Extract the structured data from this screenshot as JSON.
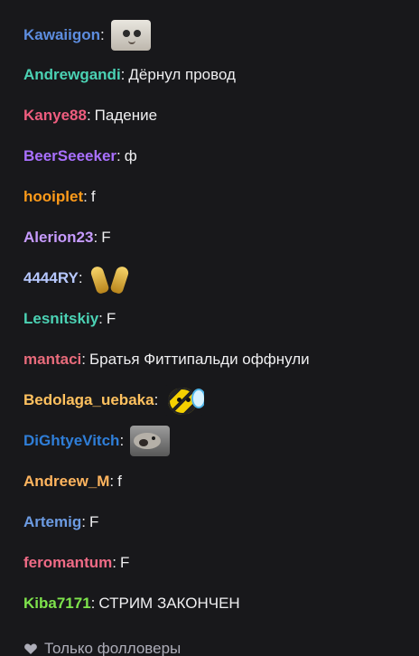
{
  "chat": {
    "cut_user": "",
    "messages": [
      {
        "user": "Kawaiigon",
        "color": "#5d8ddf",
        "text": "",
        "emote": "crying-cat-emote"
      },
      {
        "user": "Andrewgandi",
        "color": "#4bd2b4",
        "text": "Дёрнул провод",
        "emote": ""
      },
      {
        "user": "Kanye88",
        "color": "#ef5d7f",
        "text": "Падение",
        "emote": ""
      },
      {
        "user": "BeerSeeeker",
        "color": "#a970ff",
        "text": "ф",
        "emote": ""
      },
      {
        "user": "hooiplet",
        "color": "#ff9b1a",
        "text": "f",
        "emote": ""
      },
      {
        "user": "Alerion23",
        "color": "#c79bff",
        "text": "F",
        "emote": ""
      },
      {
        "user": "4444RY",
        "color": "#b7c8ff",
        "text": "",
        "emote": "praying-hands-emote"
      },
      {
        "user": "Lesnitskiy",
        "color": "#4bd2b4",
        "text": "F",
        "emote": ""
      },
      {
        "user": "mantaci",
        "color": "#e86b7b",
        "text": "Братья Фиттипальди оффнули",
        "emote": ""
      },
      {
        "user": "Bedolaga_uebaka",
        "color": "#ffc15f",
        "text": "",
        "emote": "bee-emote"
      },
      {
        "user": "DiGhtyeVitch",
        "color": "#2f7ed8",
        "text": "",
        "emote": "fish-emote"
      },
      {
        "user": "Andreew_M",
        "color": "#ffb55f",
        "text": "f",
        "emote": ""
      },
      {
        "user": "Artemig",
        "color": "#6c9be2",
        "text": "F",
        "emote": ""
      },
      {
        "user": "feromantum",
        "color": "#ef6b86",
        "text": "F",
        "emote": ""
      },
      {
        "user": "Kiba7171",
        "color": "#7ee34c",
        "text": "СТРИМ ЗАКОНЧЕН",
        "emote": ""
      }
    ]
  },
  "footer": {
    "icon": "heart-icon",
    "label": "Только фолловеры"
  }
}
